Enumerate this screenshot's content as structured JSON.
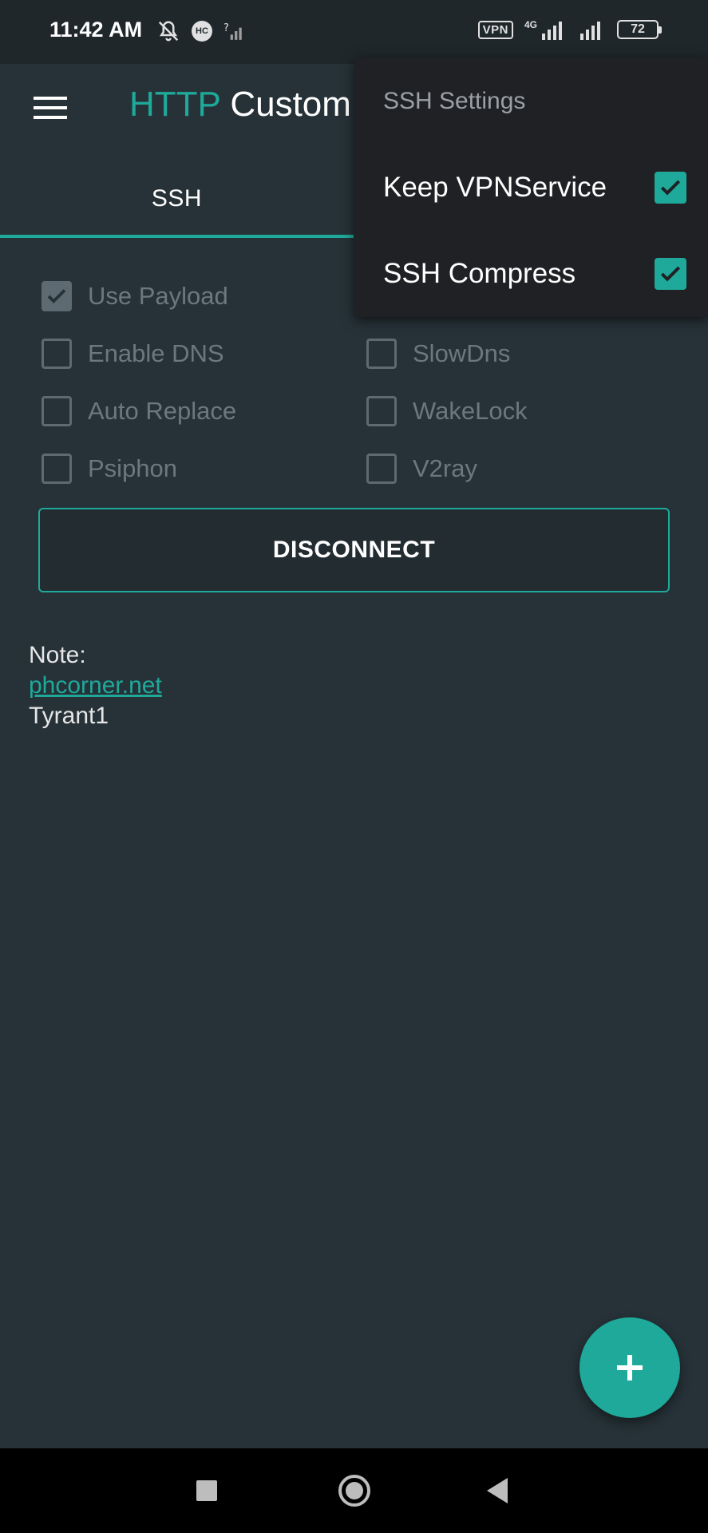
{
  "status_bar": {
    "time": "11:42 AM",
    "vpn": "VPN",
    "network": "4G",
    "battery": "72"
  },
  "app_bar": {
    "title_part1": "HTTP",
    "title_part2": "Custom"
  },
  "tabs": [
    {
      "label": "SSH",
      "active": true
    }
  ],
  "options": [
    {
      "label": "Use Payload",
      "checked": true
    },
    {
      "label": "Enable DNS",
      "checked": false
    },
    {
      "label": "SlowDns",
      "checked": false
    },
    {
      "label": "Auto Replace",
      "checked": false
    },
    {
      "label": "WakeLock",
      "checked": false
    },
    {
      "label": "Psiphon",
      "checked": false
    },
    {
      "label": "V2ray",
      "checked": false
    }
  ],
  "actions": {
    "disconnect_label": "DISCONNECT"
  },
  "note": {
    "heading": "Note:",
    "link": "phcorner.net",
    "text": "Tyrant1"
  },
  "popup": {
    "title": "SSH Settings",
    "items": [
      {
        "label": "Keep VPNService",
        "checked": true
      },
      {
        "label": "SSH Compress",
        "checked": true
      }
    ]
  },
  "colors": {
    "accent": "#1fa99a",
    "background": "#263238",
    "popup_background": "#202124"
  },
  "icons": {
    "menu": "hamburger-icon",
    "fab": "plus-icon",
    "nav_recents": "square-icon",
    "nav_home": "circle-icon",
    "nav_back": "triangle-back-icon"
  }
}
